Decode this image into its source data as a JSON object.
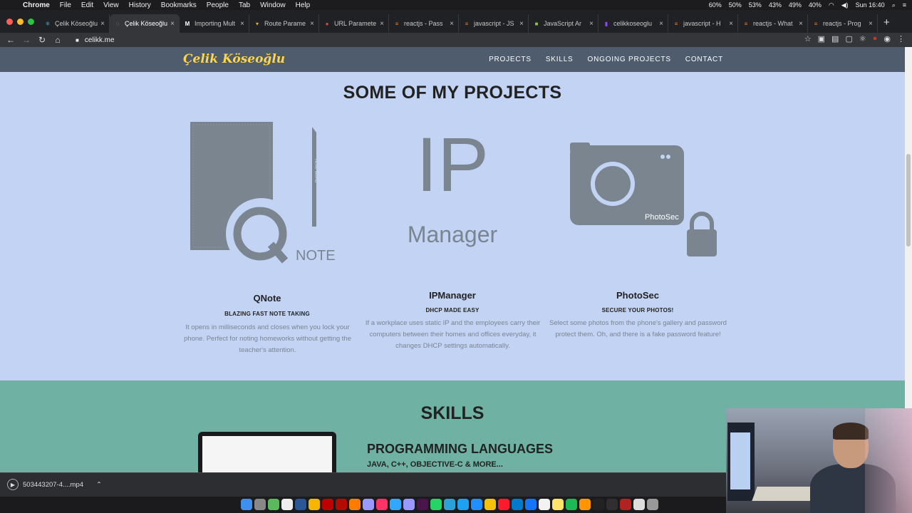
{
  "menubar": {
    "app": "Chrome",
    "items": [
      "File",
      "Edit",
      "View",
      "History",
      "Bookmarks",
      "People",
      "Tab",
      "Window",
      "Help"
    ],
    "status": [
      "60%",
      "50%",
      "53%",
      "43%",
      "49%",
      "40%"
    ],
    "clock": "Sun 16:40"
  },
  "tabs": [
    {
      "label": "Çelik Köseoğlu",
      "active": false
    },
    {
      "label": "Çelik Köseoğlu",
      "active": true
    },
    {
      "label": "Importing Mult",
      "active": false
    },
    {
      "label": "Route Parame",
      "active": false
    },
    {
      "label": "URL Paramete",
      "active": false
    },
    {
      "label": "reactjs - Pass",
      "active": false
    },
    {
      "label": "javascript - JS",
      "active": false
    },
    {
      "label": "JavaScript Ar",
      "active": false
    },
    {
      "label": "celikkoseoglu",
      "active": false
    },
    {
      "label": "javascript - H",
      "active": false
    },
    {
      "label": "reactjs - What",
      "active": false
    },
    {
      "label": "reactjs - Prog",
      "active": false
    }
  ],
  "address": {
    "url": "celikk.me"
  },
  "site": {
    "logo": "Çelik Köseoğlu",
    "nav": [
      "PROJECTS",
      "SKILLS",
      "ONGOING PROJECTS",
      "CONTACT"
    ],
    "projects_title": "SOME OF MY PROJECTS",
    "projects": [
      {
        "name": "QNote",
        "tagline": "BLAZING FAST NOTE TAKING",
        "description": "It opens in milliseconds and closes when you lock your phone. Perfect for noting homeworks without getting the teacher's attention.",
        "logo_q": "Q",
        "logo_text": "NOTE",
        "pen_text": "hello world"
      },
      {
        "name": "IPManager",
        "tagline": "DHCP MADE EASY",
        "description": "If a workplace uses static IP and the employees carry their computers between their homes and offices everyday, it changes DHCP settings automatically.",
        "logo_big": "IP",
        "logo_small": "Manager"
      },
      {
        "name": "PhotoSec",
        "tagline": "SECURE YOUR PHOTOS!",
        "description": "Select some photos from the phone's gallery and password protect them. Oh, and there is a fake password feature!",
        "logo_text": "PhotoSec"
      }
    ],
    "skills_title": "SKILLS",
    "skill_heading": "PROGRAMMING LANGUAGES",
    "skill_sub": "JAVA, C++, OBJECTIVE-C & MORE..."
  },
  "download": {
    "filename": "503443207-4....mp4"
  },
  "colors": {
    "page_bg": "#c2d3f4",
    "nav_bg": "#4e5c6e",
    "logo": "#ffd54a",
    "icon_gray": "#7a8590",
    "skills_bg": "#6fb2a3"
  }
}
